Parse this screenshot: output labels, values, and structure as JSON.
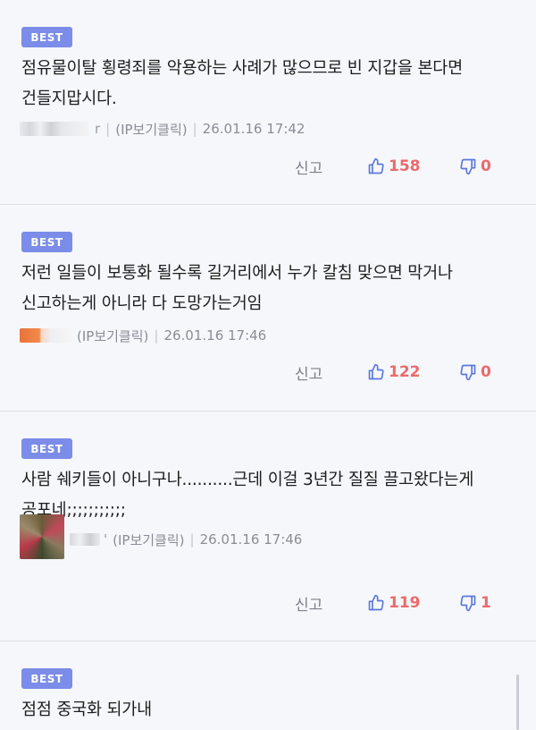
{
  "comments": [
    {
      "badge": "BEST",
      "text": "점유물이탈 횡령죄를 악용하는 사례가 많으므로 빈 지갑을 본다면 건들지맙시다.",
      "nick": "r",
      "ip": "(IP보기클릭)",
      "date": "26.01.16 17:42",
      "report": "신고",
      "likes": "158",
      "dislikes": "0"
    },
    {
      "badge": "BEST",
      "text": "저런 일들이 보통화 될수록 길거리에서 누가 칼침 맞으면 막거나 신고하는게 아니라 다 도망가는거임",
      "nick": "",
      "ip": "(IP보기클릭)",
      "date": "26.01.16 17:46",
      "report": "신고",
      "likes": "122",
      "dislikes": "0"
    },
    {
      "badge": "BEST",
      "text": "사람 쉐키들이 아니구나..........근데 이걸 3년간 질질 끌고왔다는게 공포네;;;;;;;;;;;",
      "nick": "'",
      "ip": "(IP보기클릭)",
      "date": "26.01.16 17:46",
      "report": "신고",
      "likes": "119",
      "dislikes": "1"
    },
    {
      "badge": "BEST",
      "text": "점점 중국화 되가내"
    }
  ],
  "colors": {
    "badge": "#7b8de8",
    "like_icon": "#5b78d8",
    "count": "#ea6b6b",
    "meta": "#8a8d96"
  },
  "icons": {
    "like": "thumbs-up-icon",
    "dislike": "thumbs-down-icon"
  }
}
